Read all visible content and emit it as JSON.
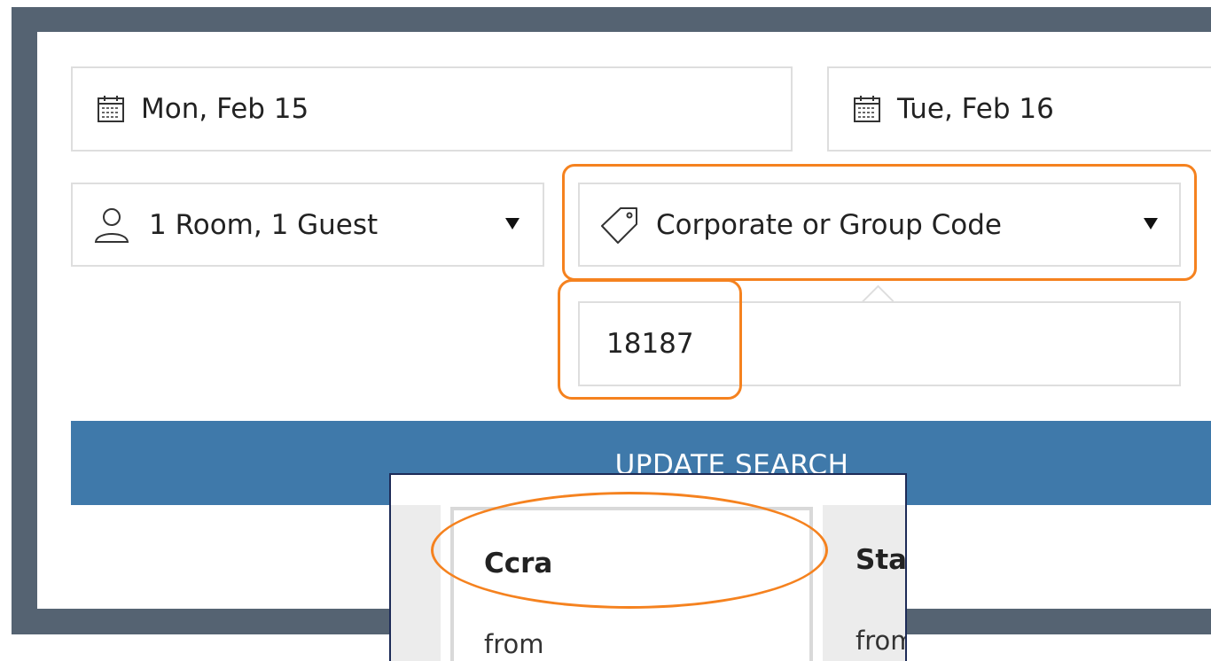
{
  "search": {
    "check_in": "Mon, Feb 15",
    "check_out": "Tue, Feb 16",
    "rooms_guests": "1 Room, 1 Guest",
    "special_rates": "Corporate or Group Code",
    "code_value": "18187",
    "update_label": "UPDATE SEARCH"
  },
  "icons": {
    "check_in": "calendar-icon",
    "check_out": "calendar-icon",
    "rooms_guests": "person-icon",
    "special_rates": "tag-icon",
    "dropdown": "caret-down-icon"
  },
  "rates": [
    {
      "name": "Ccra",
      "from_label": "from"
    },
    {
      "name": "Sta",
      "from_label": "from"
    }
  ],
  "colors": {
    "frame": "#556372",
    "button": "#3f79aa",
    "annotation": "#f5821f",
    "popup_border": "#1d2b57"
  }
}
